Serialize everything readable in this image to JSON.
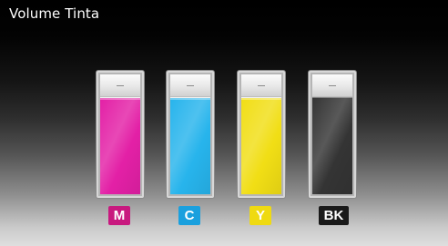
{
  "screen": {
    "title": "Volume Tinta"
  },
  "tanks": [
    {
      "label": "M",
      "level": 0.8,
      "ink_color": "#e320a6",
      "badge_color": "#c8197f"
    },
    {
      "label": "C",
      "level": 0.8,
      "ink_color": "#27b4ec",
      "badge_color": "#1aa0de"
    },
    {
      "label": "Y",
      "level": 0.8,
      "ink_color": "#f1de15",
      "badge_color": "#efda12"
    },
    {
      "label": "BK",
      "level": 0.82,
      "ink_color": "#343434",
      "badge_color": "#1a1a1a"
    }
  ]
}
